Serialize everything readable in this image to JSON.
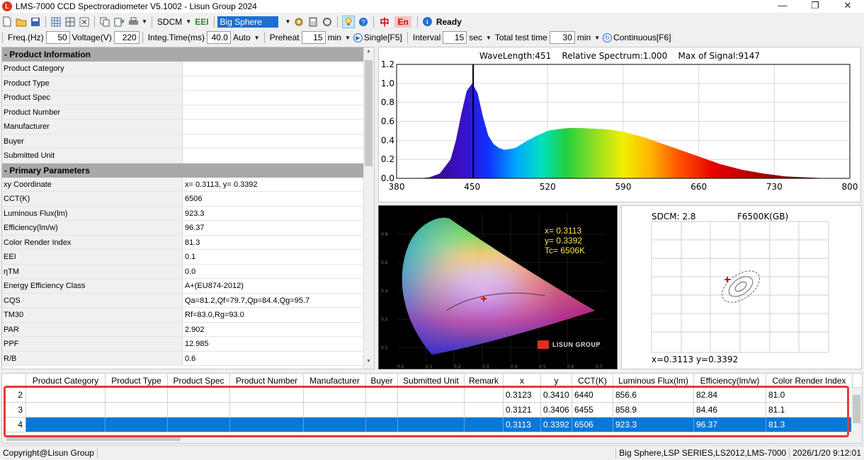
{
  "window": {
    "title": "LMS-7000 CCD Spectroradiometer V5.1002 - Lisun Group 2024",
    "minimize": "—",
    "restore": "❐",
    "close": "✕"
  },
  "toolbar1": {
    "sdcm_label": "SDCM",
    "eei_label": "EEI",
    "sphere_select": "Big Sphere",
    "lang_cn": "中",
    "lang_en": "En",
    "status": "Ready"
  },
  "toolbar2": {
    "freq_label": "Freq.(Hz)",
    "freq_value": "50",
    "voltage_label": "Voltage(V)",
    "voltage_value": "220",
    "integ_label": "Integ.Time(ms)",
    "integ_value": "40.0",
    "auto_label": "Auto",
    "preheat_label": "Preheat",
    "preheat_value": "15",
    "preheat_unit": "min",
    "single_label": "Single[F5]",
    "interval_label": "Interval",
    "interval_value": "15",
    "interval_unit": "sec",
    "total_label": "Total test time",
    "total_value": "30",
    "total_unit": "min",
    "continuous_label": "Continuous[F6]"
  },
  "product_info": {
    "header": "- Product Information",
    "rows": [
      {
        "name": "Product Category",
        "value": ""
      },
      {
        "name": "Product Type",
        "value": ""
      },
      {
        "name": "Product Spec",
        "value": ""
      },
      {
        "name": "Product Number",
        "value": ""
      },
      {
        "name": "Manufacturer",
        "value": ""
      },
      {
        "name": "Buyer",
        "value": ""
      },
      {
        "name": "Submitted Unit",
        "value": ""
      }
    ]
  },
  "primary_params": {
    "header": "- Primary Parameters",
    "rows": [
      {
        "name": "xy Coordinate",
        "value": "x= 0.3113, y= 0.3392"
      },
      {
        "name": "CCT(K)",
        "value": "6506"
      },
      {
        "name": "Luminous Flux(lm)",
        "value": "923.3"
      },
      {
        "name": "Efficiency(lm/w)",
        "value": "96.37"
      },
      {
        "name": "Color Render Index",
        "value": "81.3"
      },
      {
        "name": "EEI",
        "value": "0.1"
      },
      {
        "name": "ηTM",
        "value": "0.0"
      },
      {
        "name": "Energy Efficiency Class",
        "value": "A+(EU874-2012)"
      },
      {
        "name": "CQS",
        "value": "Qa=81.2,Qf=79.7,Qp=84.4,Qg=95.7"
      },
      {
        "name": "TM30",
        "value": "Rf=83.0,Rg=93.0"
      },
      {
        "name": "PAR",
        "value": "2.902"
      },
      {
        "name": "PPF",
        "value": "12.985"
      },
      {
        "name": "R/B",
        "value": "0.6"
      }
    ]
  },
  "spectrum": {
    "info": "WaveLength:451    Relative Spectrum:1.000    Max of Signal:9147",
    "cursor_nm": 451
  },
  "chart_data": {
    "type": "area",
    "title": "",
    "xlabel": "",
    "ylabel": "",
    "xlim": [
      380,
      800
    ],
    "ylim": [
      0,
      1.2
    ],
    "x_ticks": [
      "380",
      "450",
      "520",
      "590",
      "660",
      "730",
      "800"
    ],
    "y_ticks": [
      "0.0",
      "0.2",
      "0.4",
      "0.6",
      "0.8",
      "1.0",
      "1.2"
    ],
    "x": [
      400,
      410,
      420,
      430,
      435,
      440,
      445,
      450,
      455,
      460,
      465,
      470,
      475,
      480,
      490,
      500,
      510,
      520,
      530,
      540,
      550,
      560,
      570,
      580,
      590,
      600,
      610,
      620,
      630,
      640,
      660,
      680,
      700,
      720,
      740,
      760,
      780
    ],
    "y": [
      0.0,
      0.01,
      0.05,
      0.2,
      0.4,
      0.68,
      0.92,
      1.0,
      0.9,
      0.65,
      0.45,
      0.36,
      0.32,
      0.3,
      0.32,
      0.39,
      0.45,
      0.5,
      0.52,
      0.53,
      0.53,
      0.525,
      0.52,
      0.51,
      0.49,
      0.46,
      0.43,
      0.39,
      0.35,
      0.31,
      0.23,
      0.15,
      0.09,
      0.05,
      0.02,
      0.01,
      0.0
    ]
  },
  "cie": {
    "x_label": "x= 0.3113",
    "y_label": "y= 0.3392",
    "tc_label": "Tc= 6506K",
    "brand": "LISUN GROUP"
  },
  "sdcm": {
    "title": "SDCM: 2.8",
    "standard": "F6500K(GB)",
    "coords": "x=0.3113  y=0.3392"
  },
  "table": {
    "columns": [
      "",
      "Product Category",
      "Product Type",
      "Product Spec",
      "Product Number",
      "Manufacturer",
      "Buyer",
      "Submitted Unit",
      "Remark",
      "x",
      "y",
      "CCT(K)",
      "Luminous Flux(lm)",
      "Efficiency(lm/w)",
      "Color Render Index"
    ],
    "rows": [
      [
        "2",
        "",
        "",
        "",
        "",
        "",
        "",
        "",
        "",
        "0.3123",
        "0.3410",
        "6440",
        "856.6",
        "82.84",
        "81.0"
      ],
      [
        "3",
        "",
        "",
        "",
        "",
        "",
        "",
        "",
        "",
        "0.3121",
        "0.3406",
        "6455",
        "858.9",
        "84.46",
        "81.1"
      ],
      [
        "4",
        "",
        "",
        "",
        "",
        "",
        "",
        "",
        "",
        "0.3113",
        "0.3392",
        "6506",
        "923.3",
        "96.37",
        "81.3"
      ]
    ],
    "selected_row": 2
  },
  "statusbar": {
    "copyright": "Copyright@Lisun Group",
    "device": "Big Sphere,LSP SERIES,LS2012,LMS-7000",
    "datetime": "2026/1/20 9:12:01"
  }
}
